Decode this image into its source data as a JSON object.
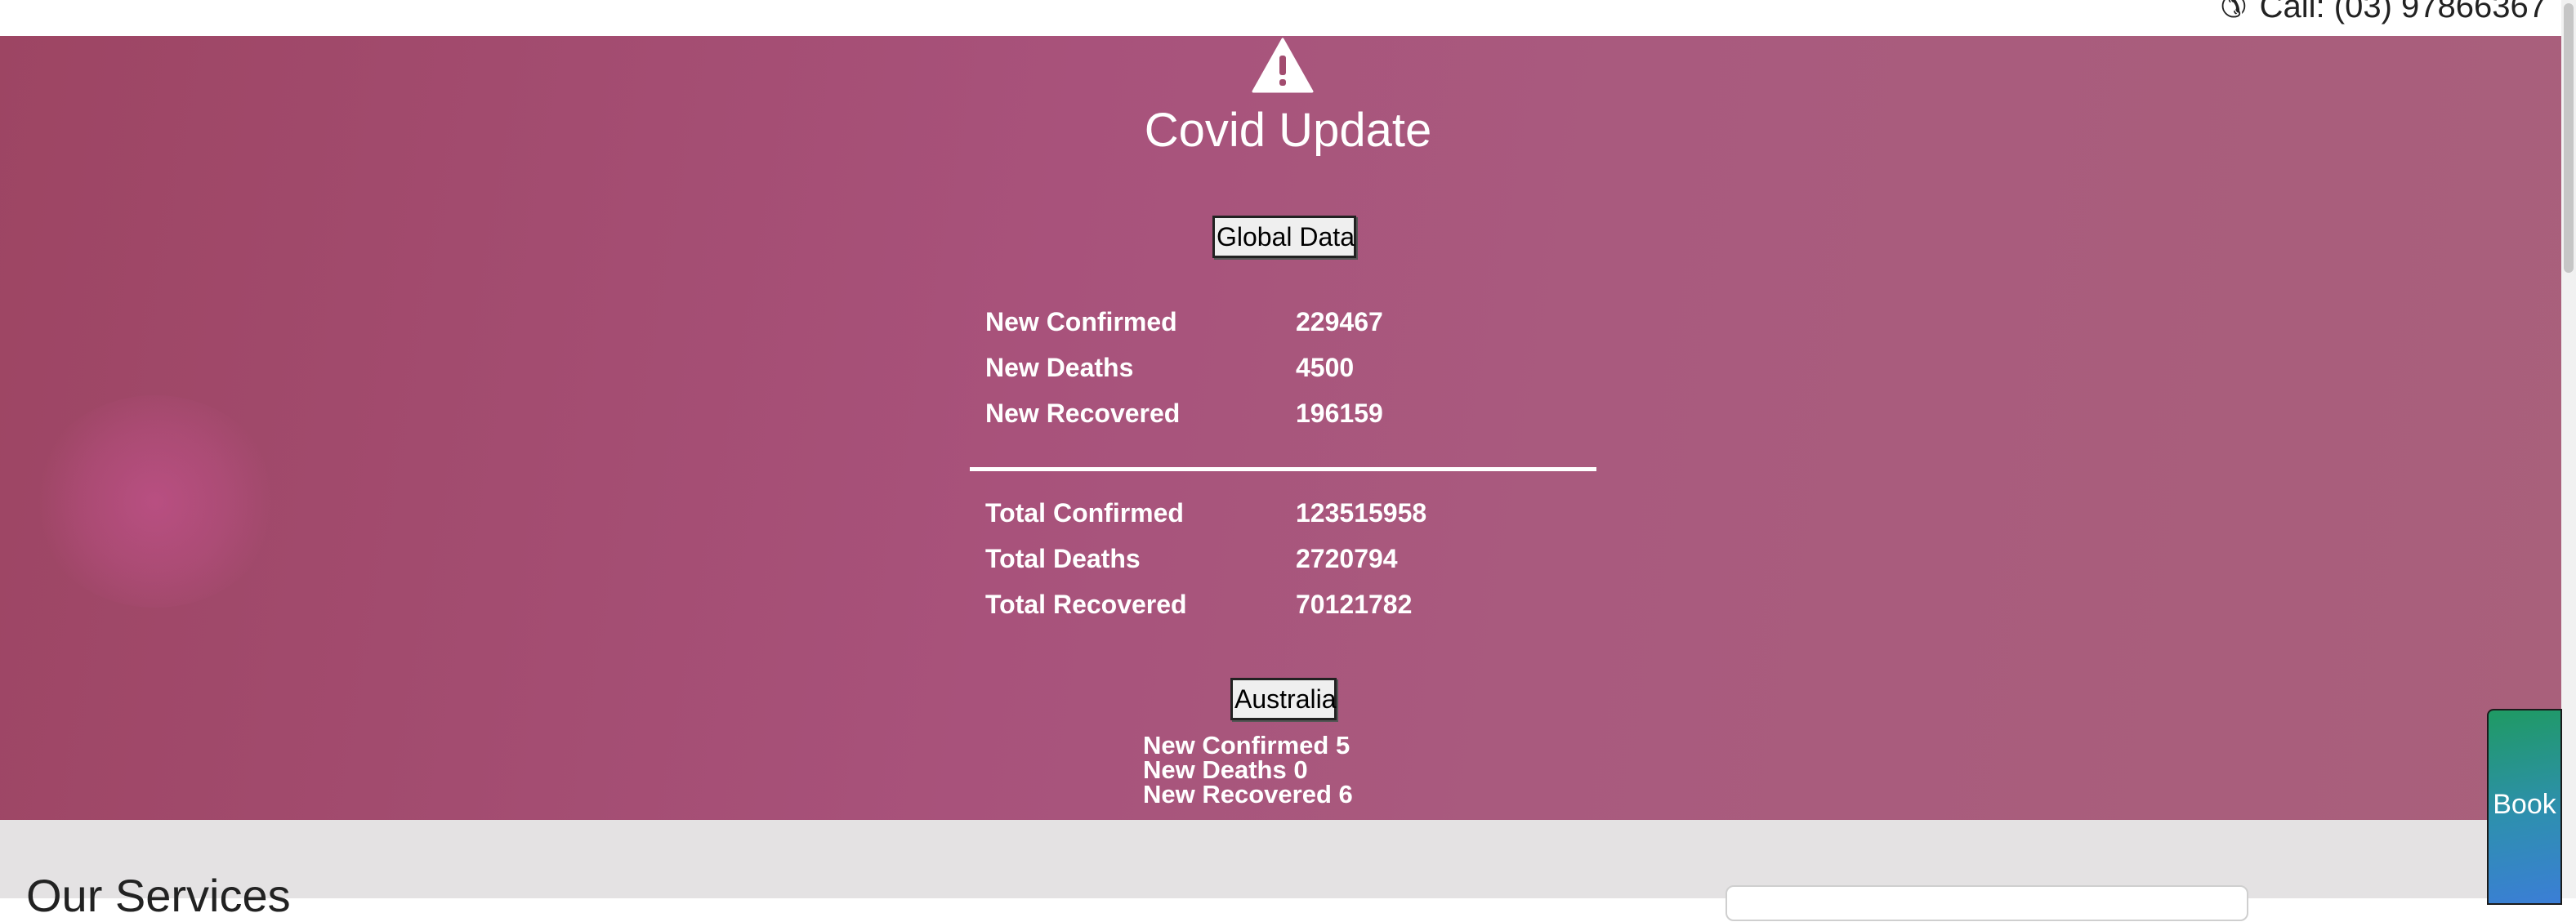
{
  "topbar": {
    "call_text": "Call: (03) 97866367",
    "phone_icon": "phone-icon"
  },
  "covid": {
    "warning_icon": "warning-icon",
    "title": "Covid Update",
    "global_button": "Global Data",
    "global_new": [
      {
        "label": "New Confirmed",
        "value": "229467"
      },
      {
        "label": "New Deaths",
        "value": "4500"
      },
      {
        "label": "New Recovered",
        "value": "196159"
      }
    ],
    "global_total": [
      {
        "label": "Total Confirmed",
        "value": "123515958"
      },
      {
        "label": "Total Deaths",
        "value": "2720794"
      },
      {
        "label": "Total Recovered",
        "value": "70121782"
      }
    ],
    "australia_button": "Australia",
    "australia": [
      "New Confirmed 5",
      "New Deaths 0",
      "New Recovered 6"
    ]
  },
  "services": {
    "title": "Our Services"
  },
  "book": {
    "label": "Book"
  },
  "colors": {
    "hero_start": "#9d4563",
    "hero_end": "#a9607b",
    "book_top": "#1f9a63",
    "book_bottom": "#3b7ed6"
  }
}
